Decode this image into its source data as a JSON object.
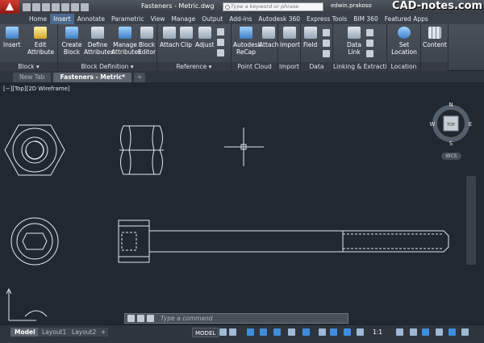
{
  "app": {
    "title": "Fasteners - Metric.dwg",
    "search_placeholder": "Type a keyword or phrase",
    "user": "edwin.prakoso",
    "watermark": "CAD-notes.com"
  },
  "ribbon_tabs": [
    "Home",
    "Insert",
    "Annotate",
    "Parametric",
    "View",
    "Manage",
    "Output",
    "Add-ins",
    "Autodesk 360",
    "Express Tools",
    "BIM 360",
    "Featured Apps"
  ],
  "active_ribbon_tab": "Insert",
  "panels": {
    "block": {
      "label": "Block ▾",
      "tools": [
        "Insert",
        "Edit Attribute"
      ]
    },
    "block_definition": {
      "label": "Block Definition ▾",
      "tools": [
        "Create Block",
        "Define Attributes",
        "Manage Attributes",
        "Block Editor"
      ]
    },
    "reference": {
      "label": "Reference ▾",
      "tools": [
        "Attach",
        "Clip",
        "Adjust"
      ]
    },
    "point_cloud": {
      "label": "Point Cloud",
      "tools": [
        "Autodesk ReCap",
        "Attach"
      ]
    },
    "import": {
      "label": "Import",
      "tools": [
        "Import"
      ]
    },
    "data": {
      "label": "Data",
      "tools": [
        "Field"
      ]
    },
    "linking": {
      "label": "Linking & Extraction",
      "tools": [
        "Data Link"
      ]
    },
    "location": {
      "label": "Location",
      "tools": [
        "Set Location"
      ]
    },
    "content": {
      "label": "",
      "tools": [
        "Content"
      ]
    }
  },
  "file_tabs": [
    {
      "label": "New Tab",
      "active": false
    },
    {
      "label": "Fasteners - Metric*",
      "active": true
    },
    {
      "label": "+",
      "active": false
    }
  ],
  "viewport": {
    "label": "[−][Top][2D Wireframe]",
    "compass": {
      "n": "N",
      "s": "S",
      "e": "E",
      "w": "W",
      "top": "TOP"
    },
    "wcs": "WCS"
  },
  "command_line": {
    "placeholder": "Type a command"
  },
  "layout_tabs": [
    {
      "label": "Model",
      "active": true
    },
    {
      "label": "Layout1",
      "active": false
    },
    {
      "label": "Layout2",
      "active": false
    }
  ],
  "status_bar": {
    "model": "MODEL",
    "scale": "1:1"
  },
  "colors": {
    "canvas": "#212830",
    "ribbon": "#474d56",
    "accent": "#4a6a8e",
    "app_button": "#c8302a"
  }
}
